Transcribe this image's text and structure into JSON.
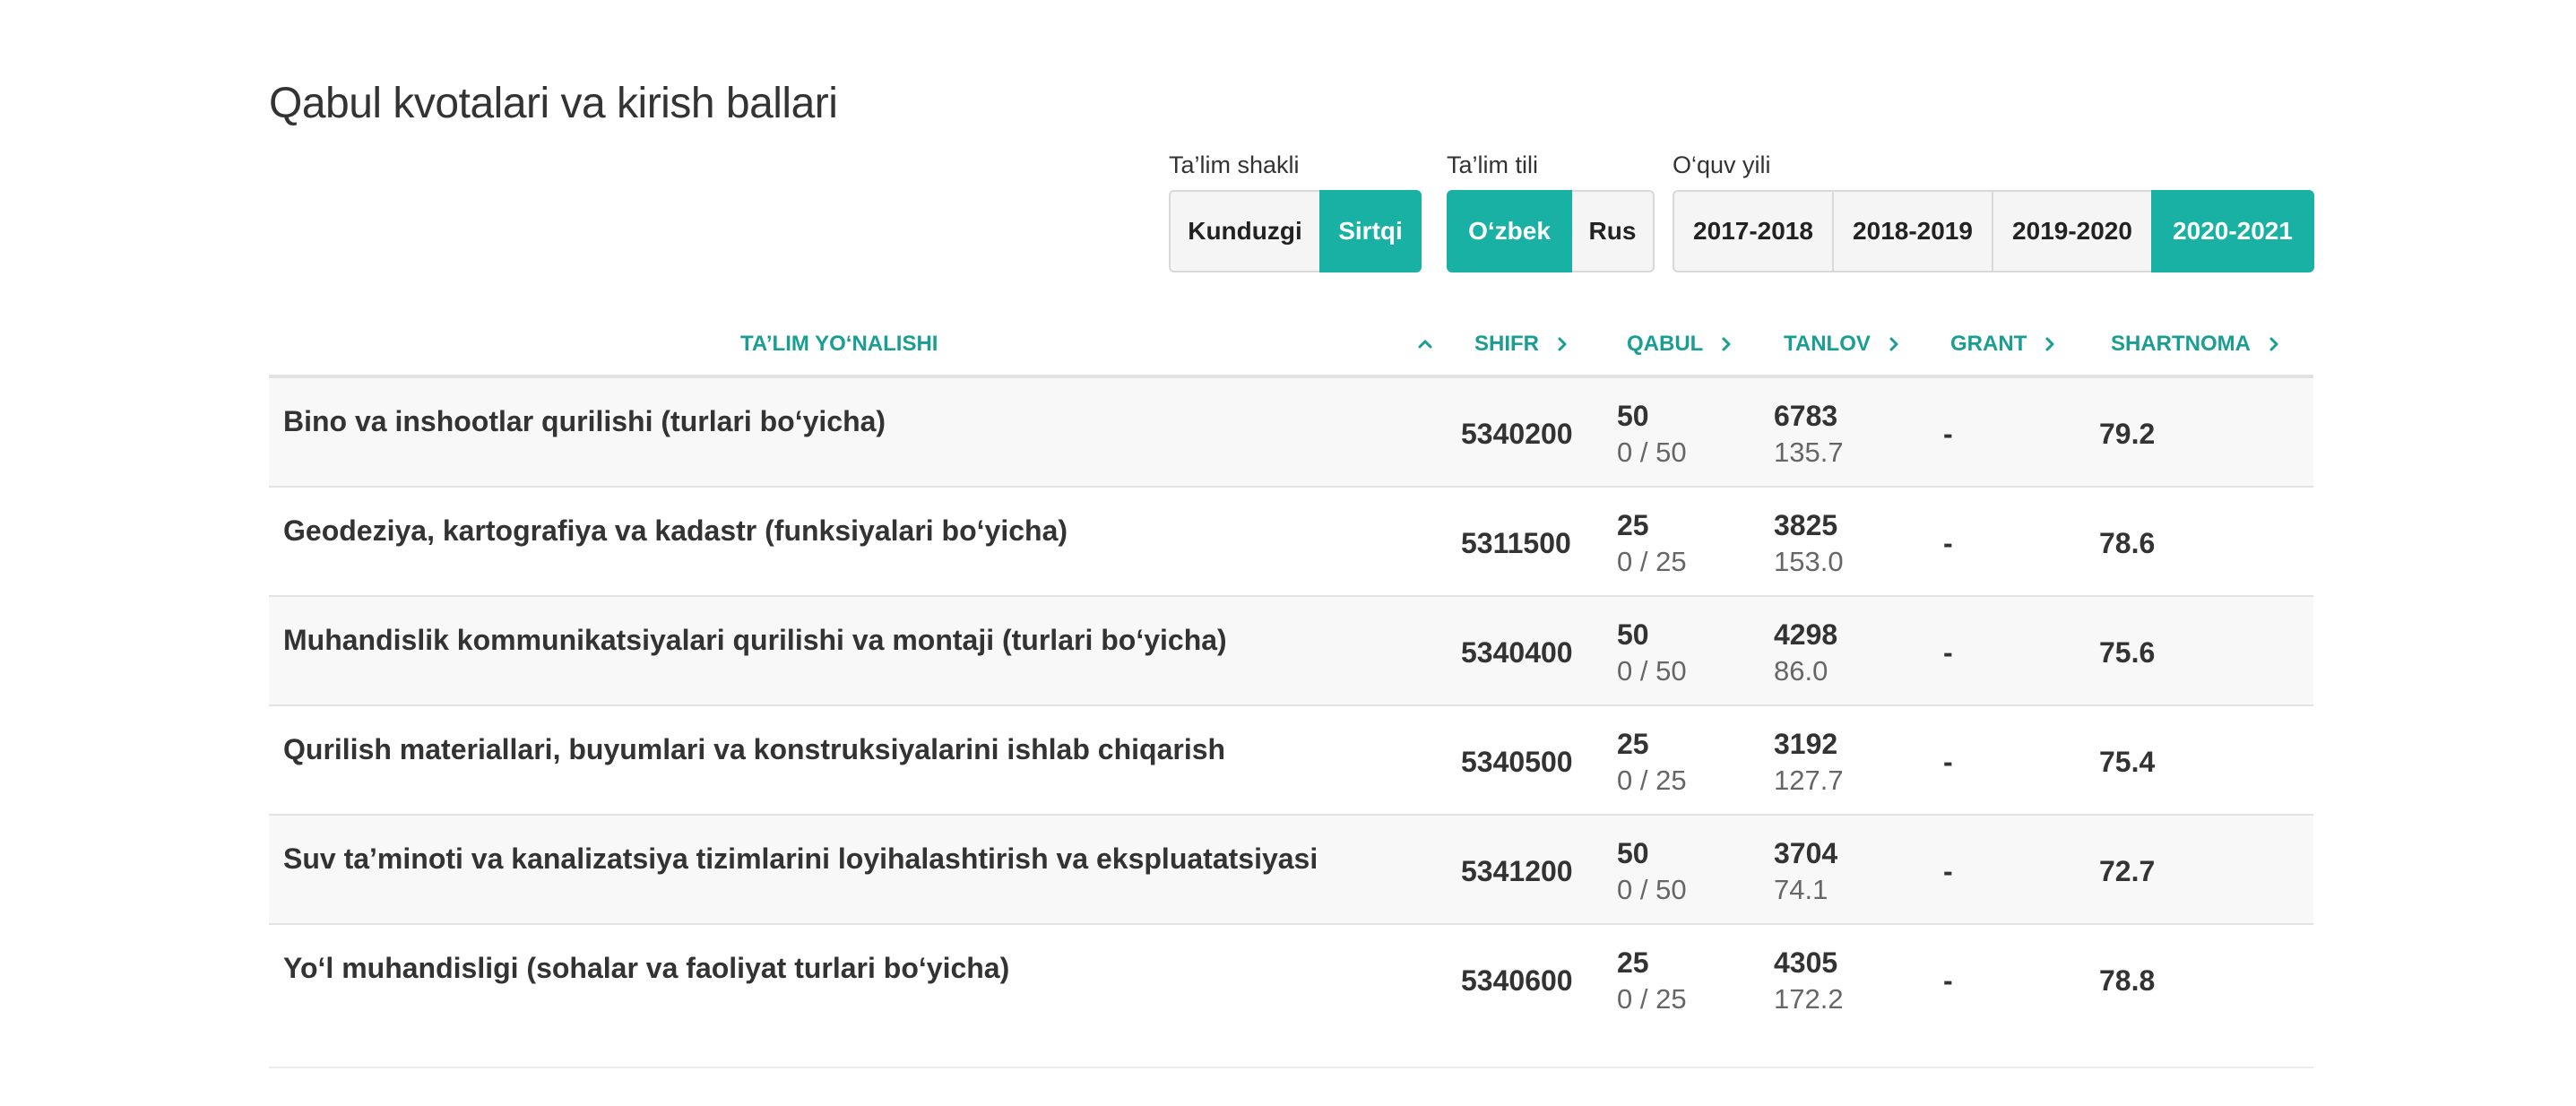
{
  "page": {
    "title": "Qabul kvotalari va kirish ballari"
  },
  "colors": {
    "accent": "#19b1a3",
    "header_text": "#1a9e93"
  },
  "filters": {
    "talim_shakli": {
      "label": "Ta’lim shakli",
      "options": [
        "Kunduzgi",
        "Sirtqi"
      ],
      "selected": "Sirtqi"
    },
    "talim_tili": {
      "label": "Ta’lim tili",
      "options": [
        "O‘zbek",
        "Rus"
      ],
      "selected": "O‘zbek"
    },
    "oquv_yili": {
      "label": "O‘quv yili",
      "options": [
        "2017-2018",
        "2018-2019",
        "2019-2020",
        "2020-2021"
      ],
      "selected": "2020-2021"
    }
  },
  "table": {
    "headers": {
      "yonalish": "TA’LIM YO‘NALISHI",
      "shifr": "SHIFR",
      "qabul": "QABUL",
      "tanlov": "TANLOV",
      "grant": "GRANT",
      "shartnoma": "SHARTNOMA"
    },
    "sort": {
      "column": "yonalish",
      "direction": "ascending",
      "icons": {
        "active": "chevron-up-icon",
        "inactive": "chevron-right-icon"
      }
    },
    "rows": [
      {
        "name": "Bino va inshootlar qurilishi (turlari bo‘yicha)",
        "shifr": "5340200",
        "qabul": "50",
        "qabul_sub": "0 / 50",
        "tanlov": "6783",
        "tanlov_sub": "135.7",
        "grant": "-",
        "shartnoma": "79.2"
      },
      {
        "name": "Geodeziya, kartografiya va kadastr (funksiyalari bo‘yicha)",
        "shifr": "5311500",
        "qabul": "25",
        "qabul_sub": "0 / 25",
        "tanlov": "3825",
        "tanlov_sub": "153.0",
        "grant": "-",
        "shartnoma": "78.6"
      },
      {
        "name": "Muhandislik kommunikatsiyalari qurilishi va montaji (turlari bo‘yicha)",
        "shifr": "5340400",
        "qabul": "50",
        "qabul_sub": "0 / 50",
        "tanlov": "4298",
        "tanlov_sub": "86.0",
        "grant": "-",
        "shartnoma": "75.6"
      },
      {
        "name": "Qurilish materiallari, buyumlari va konstruksiyalarini ishlab chiqarish",
        "shifr": "5340500",
        "qabul": "25",
        "qabul_sub": "0 / 25",
        "tanlov": "3192",
        "tanlov_sub": "127.7",
        "grant": "-",
        "shartnoma": "75.4"
      },
      {
        "name": "Suv ta’minoti va kanalizatsiya tizimlarini loyihalashtirish va ekspluatatsiyasi",
        "shifr": "5341200",
        "qabul": "50",
        "qabul_sub": "0 / 50",
        "tanlov": "3704",
        "tanlov_sub": "74.1",
        "grant": "-",
        "shartnoma": "72.7"
      },
      {
        "name": "Yo‘l muhandisligi (sohalar va faoliyat turlari bo‘yicha)",
        "shifr": "5340600",
        "qabul": "25",
        "qabul_sub": "0 / 25",
        "tanlov": "4305",
        "tanlov_sub": "172.2",
        "grant": "-",
        "shartnoma": "78.8"
      }
    ]
  }
}
